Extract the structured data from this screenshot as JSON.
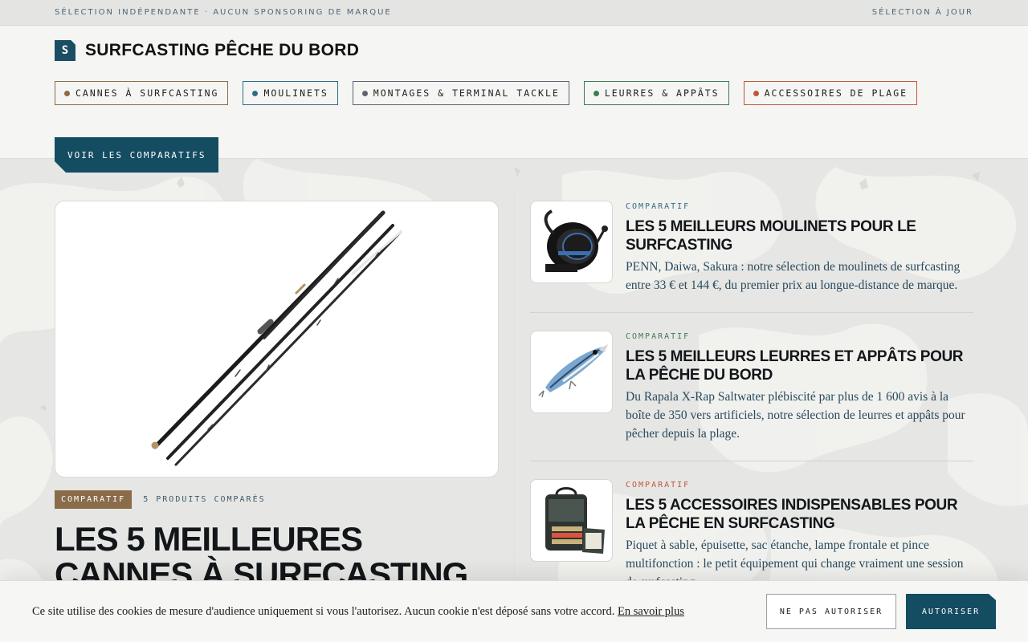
{
  "topbar": {
    "left": "SÉLECTION INDÉPENDANTE · AUCUN SPONSORING DE MARQUE",
    "right": "SÉLECTION À JOUR"
  },
  "brand": {
    "logo_letter": "S",
    "name": "SURFCASTING PÊCHE DU BORD"
  },
  "nav": [
    {
      "label": "CANNES À SURFCASTING",
      "color": "#8a6b4a"
    },
    {
      "label": "MOULINETS",
      "color": "#2f6d86"
    },
    {
      "label": "MONTAGES & TERMINAL TACKLE",
      "color": "#5b6570"
    },
    {
      "label": "LEURRES & APPÂTS",
      "color": "#3f7a55"
    },
    {
      "label": "ACCESSOIRES DE PLAGE",
      "color": "#c0573a"
    }
  ],
  "cta_label": "VOIR LES COMPARATIFS",
  "featured": {
    "badge": "COMPARATIF",
    "count": "5 PRODUITS COMPARÉS",
    "title": "LES 5 MEILLEURES CANNES À SURFCASTING"
  },
  "articles": [
    {
      "kicker": "COMPARATIF",
      "kicker_color": "#2f6d86",
      "title": "LES 5 MEILLEURS MOULINETS POUR LE SURFCASTING",
      "desc": "PENN, Daiwa, Sakura : notre sélection de moulinets de surfcasting entre 33 € et 144 €, du premier prix au longue-distance de marque.",
      "icon": "reel-image"
    },
    {
      "kicker": "COMPARATIF",
      "kicker_color": "#3f7a55",
      "title": "LES 5 MEILLEURS LEURRES ET APPÂTS POUR LA PÊCHE DU BORD",
      "desc": "Du Rapala X-Rap Saltwater plébiscité par plus de 1 600 avis à la boîte de 350 vers artificiels, notre sélection de leurres et appâts pour pêcher depuis la plage.",
      "icon": "lure-image"
    },
    {
      "kicker": "COMPARATIF",
      "kicker_color": "#c0573a",
      "title": "LES 5 ACCESSOIRES INDISPENSABLES POUR LA PÊCHE EN SURFCASTING",
      "desc": "Piquet à sable, épuisette, sac étanche, lampe frontale et pince multifonction : le petit équipement qui change vraiment une session de surfcasting.",
      "icon": "tackle-bag-image"
    }
  ],
  "cookie": {
    "text": "Ce site utilise des cookies de mesure d'audience uniquement si vous l'autorisez. Aucun cookie n'est déposé sans votre accord.",
    "link": "En savoir plus",
    "deny": "NE PAS AUTORISER",
    "accept": "AUTORISER"
  }
}
